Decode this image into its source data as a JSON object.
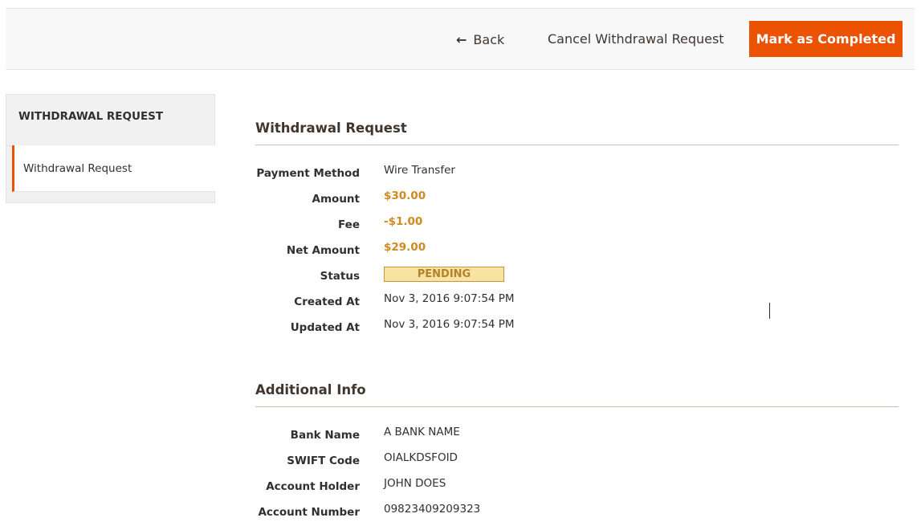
{
  "header": {
    "back_label": "Back",
    "back_icon": "arrow-left-icon",
    "cancel_label": "Cancel Withdrawal Request",
    "primary_label": "Mark as Completed"
  },
  "sidebar": {
    "title": "WITHDRAWAL REQUEST",
    "items": [
      {
        "label": "Withdrawal Request",
        "active": true
      }
    ]
  },
  "withdrawal": {
    "title": "Withdrawal Request",
    "rows": [
      {
        "label": "Payment Method",
        "value": "Wire Transfer"
      },
      {
        "label": "Amount",
        "value": "$30.00"
      },
      {
        "label": "Fee",
        "value": "-$1.00"
      },
      {
        "label": "Net Amount",
        "value": "$29.00"
      },
      {
        "label": "Status",
        "value": "PENDING"
      },
      {
        "label": "Created At",
        "value": "Nov 3, 2016 9:07:54 PM"
      },
      {
        "label": "Updated At",
        "value": "Nov 3, 2016 9:07:54 PM"
      }
    ]
  },
  "additional": {
    "title": "Additional Info",
    "rows": [
      {
        "label": "Bank Name",
        "value": "A BANK NAME"
      },
      {
        "label": "SWIFT Code",
        "value": "OIALKDSFOID"
      },
      {
        "label": "Account Holder",
        "value": "JOHN DOES"
      },
      {
        "label": "Account Number",
        "value": "09823409209323"
      }
    ]
  },
  "colors": {
    "accent": "#eb5202",
    "money": "#d08a22",
    "status_bg": "#f7e4a3",
    "status_border": "#c8953a"
  }
}
